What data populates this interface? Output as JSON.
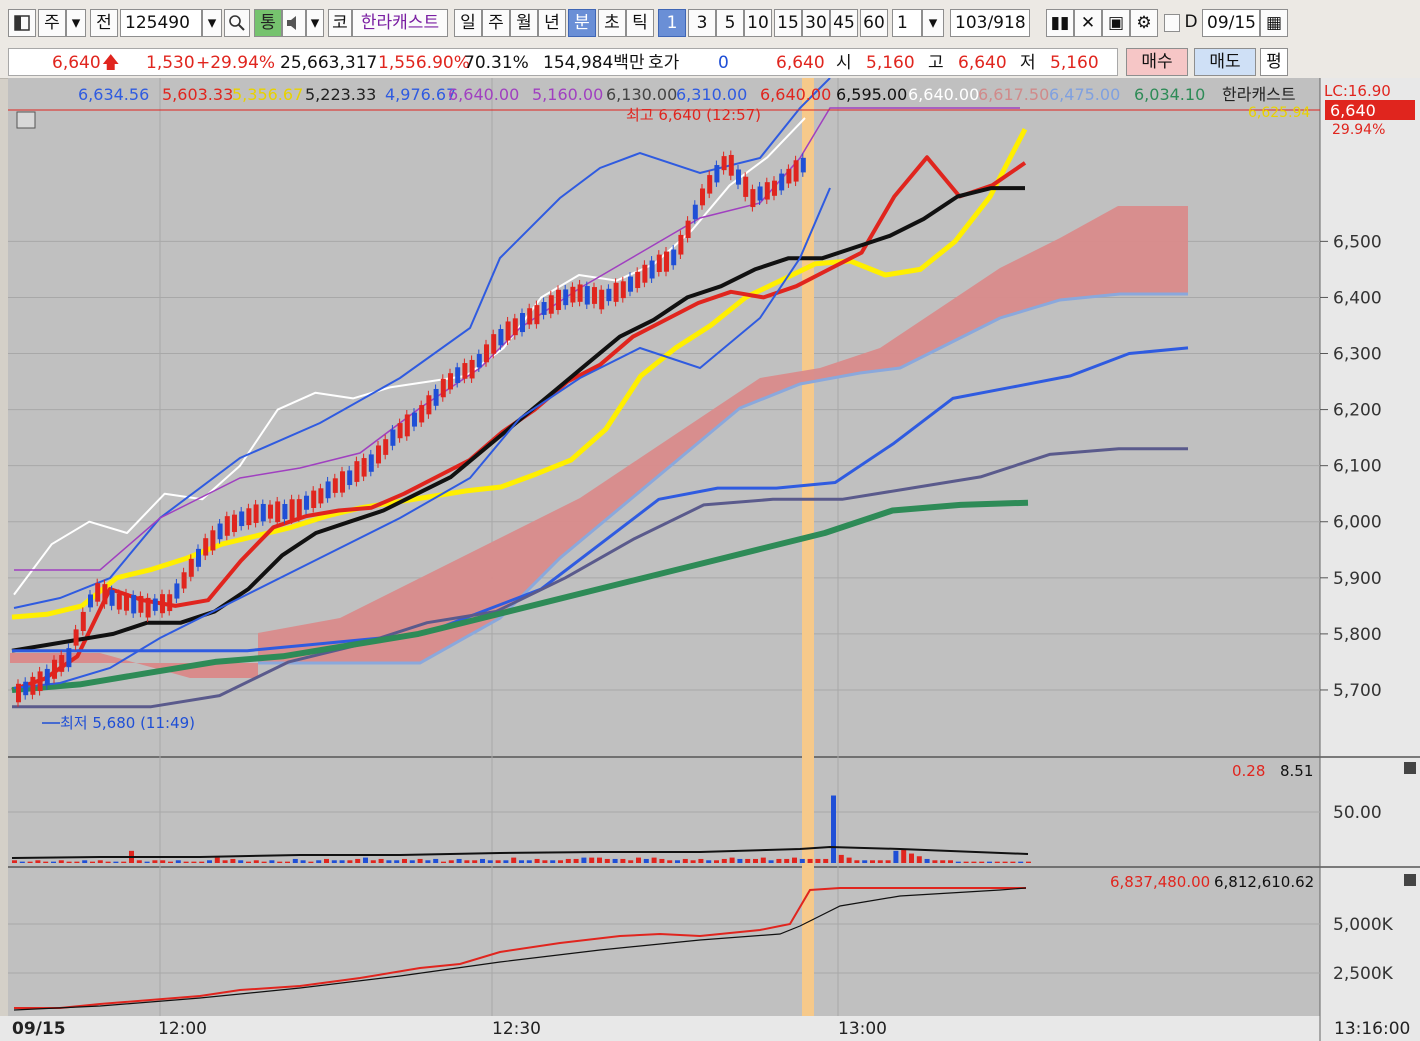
{
  "toolbar": {
    "market": "주",
    "all": "전",
    "code": "125490",
    "link": "통",
    "name_prefix": "코",
    "name": "한라캐스트",
    "periods": [
      "일",
      "주",
      "월",
      "년",
      "분",
      "초",
      "틱"
    ],
    "active_period": "분",
    "intervals": [
      "1",
      "3",
      "5",
      "10",
      "15",
      "30",
      "45",
      "60"
    ],
    "active_interval": "1",
    "step": "1",
    "count": "103",
    "count_total": "/918",
    "date_toggle": "D",
    "date": "09/15"
  },
  "info": {
    "price": "6,640",
    "change": "1,530",
    "change_pct": "+29.94%",
    "volume": "25,663,317",
    "volume_pct": "1,556.90%",
    "turnover_pct": "70.31%",
    "amount": "154,984백만",
    "hoga_label": "호가",
    "hoga_value": "0",
    "last": "6,640",
    "open_label": "시",
    "open": "5,160",
    "high_label": "고",
    "high": "6,640",
    "low_label": "저",
    "low": "5,160",
    "buy": "매수",
    "sell": "매도",
    "eval": "평"
  },
  "colors": {
    "up": "#e0251e",
    "down": "#1f4fd6",
    "ma5": "#ffef00",
    "bb": "#2f5be0",
    "cloud": "#d98b8b",
    "chart_bg": "#c0c0c0",
    "highlight": "#f6c98a",
    "spanA": "#2f5be0",
    "spanB": "#5a5a8c",
    "ma_green": "#2e8b57"
  },
  "legend": [
    {
      "text": "6,634.56",
      "color": "#2f5be0"
    },
    {
      "text": "5,603.33",
      "color": "#e0251e"
    },
    {
      "text": "5,356.67",
      "color": "#e8d200"
    },
    {
      "text": "5,223.33",
      "color": "#222222"
    },
    {
      "text": "4,976.67",
      "color": "#2f5be0"
    },
    {
      "text": "6,640.00",
      "color": "#a040c0"
    },
    {
      "text": "5,160.00",
      "color": "#a040c0"
    },
    {
      "text": "6,130.00",
      "color": "#444444"
    },
    {
      "text": "6,310.00",
      "color": "#2f5be0"
    },
    {
      "text": "6,640.00",
      "color": "#e0251e"
    },
    {
      "text": "6,595.00",
      "color": "#111111"
    },
    {
      "text": "6,640.00",
      "color": "#ffffff"
    },
    {
      "text": "6,617.50",
      "color": "#d08a8a"
    },
    {
      "text": "6,475.00",
      "color": "#7fa0e0"
    },
    {
      "text": "6,034.10",
      "color": "#2e8b57"
    },
    {
      "text": "한라캐스트",
      "color": "#222222"
    }
  ],
  "badges": {
    "lc": "LC:16.90",
    "price": "6,640",
    "ma5_value": "6,625.94",
    "pct": "29.94%"
  },
  "annotations": {
    "high": "최고 6,640 (12:57)",
    "low": "최저 5,680 (11:49)"
  },
  "chart_data": [
    {
      "type": "line",
      "title": "",
      "y_ticks": [
        "6,500",
        "6,400",
        "6,300",
        "6,200",
        "6,100",
        "6,000",
        "5,900",
        "5,800",
        "5,700"
      ],
      "ylim": [
        5650,
        6720
      ],
      "x_ticks": [
        "09/15",
        "12:00",
        "12:30",
        "13:00",
        "13:16:00"
      ],
      "series": [
        {
          "type": "line",
          "color": "#ffef00",
          "values": [
            5830,
            5835,
            5850,
            5900,
            5915,
            5935,
            5960,
            5975,
            5990,
            6010,
            6025,
            6035,
            6045,
            6055,
            6062,
            6085,
            6110,
            6165,
            6260,
            6310,
            6350,
            6400,
            6430,
            6460,
            6465,
            6440,
            6450,
            6500,
            6580,
            6700
          ]
        },
        {
          "type": "line",
          "color": "#e0251e",
          "values": [
            5700,
            5720,
            5760,
            5880,
            5860,
            5850,
            5860,
            5930,
            5990,
            6010,
            6020,
            6025,
            6050,
            6080,
            6110,
            6160,
            6200,
            6250,
            6280,
            6330,
            6360,
            6390,
            6410,
            6400,
            6420,
            6450,
            6480,
            6580,
            6650,
            6580,
            6600,
            6640
          ]
        },
        {
          "type": "line",
          "color": "#111111",
          "values": [
            5770,
            5780,
            5790,
            5800,
            5820,
            5820,
            5840,
            5880,
            5940,
            5980,
            6000,
            6020,
            6050,
            6080,
            6130,
            6180,
            6230,
            6280,
            6330,
            6360,
            6400,
            6420,
            6450,
            6470,
            6470,
            6490,
            6510,
            6540,
            6580,
            6595,
            6595
          ]
        },
        {
          "type": "line",
          "color": "#ffffff",
          "values": [
            5870,
            5960,
            6000,
            5980,
            6050,
            6040,
            6100,
            6200,
            6230,
            6220,
            6240,
            6250,
            6260,
            6310,
            6400,
            6440,
            6430,
            6460,
            6520,
            6600,
            6650,
            6720
          ]
        },
        {
          "type": "line",
          "color": "#2f5be0",
          "values": [
            5770,
            5770,
            5770,
            5770,
            5770,
            5780,
            5790,
            5800,
            5840,
            5880,
            5960,
            6040,
            6060,
            6060,
            6070,
            6140,
            6220,
            6240,
            6260,
            6300,
            6310
          ]
        },
        {
          "type": "line",
          "color": "#5a5a8c",
          "values": [
            5670,
            5670,
            5670,
            5690,
            5750,
            5780,
            5820,
            5840,
            5900,
            5970,
            6030,
            6040,
            6040,
            6060,
            6080,
            6120,
            6130,
            6130
          ]
        },
        {
          "type": "line",
          "color": "#2e8b57",
          "values": [
            5700,
            5710,
            5730,
            5750,
            5760,
            5780,
            5800,
            5830,
            5860,
            5890,
            5920,
            5950,
            5980,
            6020,
            6030,
            6034
          ]
        }
      ]
    },
    {
      "type": "bar",
      "title": "",
      "legend_values": [
        "0.28",
        "8.51"
      ],
      "y_ticks": [
        "50.00"
      ],
      "values": [
        2,
        1,
        1,
        2,
        1,
        1,
        2,
        1,
        1,
        2,
        1,
        2,
        1,
        1,
        1,
        9,
        2,
        1,
        2,
        2,
        1,
        2,
        1,
        1,
        1,
        2,
        4,
        2,
        3,
        2,
        1,
        2,
        1,
        2,
        1,
        1,
        3,
        2,
        1,
        2,
        3,
        2,
        2,
        2,
        3,
        4,
        2,
        3,
        2,
        2,
        3,
        2,
        3,
        2,
        3,
        1,
        2,
        3,
        2,
        2,
        3,
        2,
        2,
        2,
        4,
        2,
        2,
        3,
        2,
        2,
        2,
        3,
        3,
        4,
        4,
        4,
        3,
        3,
        3,
        2,
        4,
        3,
        4,
        3,
        2,
        2,
        3,
        2,
        3,
        2,
        2,
        3,
        4,
        3,
        3,
        3,
        4,
        2,
        3,
        3,
        4,
        3,
        3,
        3,
        3,
        50,
        6,
        4,
        2,
        2,
        2,
        2,
        2,
        9,
        10,
        7,
        5,
        3,
        2,
        2,
        2,
        1,
        1,
        1,
        1,
        1,
        1,
        1,
        1,
        1,
        1,
        1
      ]
    },
    {
      "type": "line",
      "title": "",
      "legend_values": [
        "6,837,480.00",
        "6,812,610.62"
      ],
      "y_ticks": [
        "5,000K",
        "2,500K"
      ]
    }
  ]
}
